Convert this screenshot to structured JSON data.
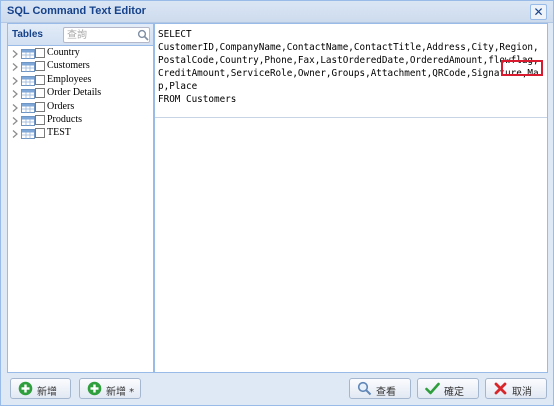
{
  "window": {
    "title": "SQL Command Text Editor"
  },
  "tables_panel": {
    "title": "Tables",
    "search_placeholder": "查詢",
    "items": [
      {
        "label": "Country"
      },
      {
        "label": "Customers"
      },
      {
        "label": "Employees"
      },
      {
        "label": "Order Details"
      },
      {
        "label": "Orders"
      },
      {
        "label": "Products"
      },
      {
        "label": "TEST"
      }
    ]
  },
  "editor": {
    "sql_text": "SELECT\nCustomerID,CompanyName,ContactName,ContactTitle,Address,City,Region,PostalCode,Country,Phone,Fax,LastOrderedDate,OrderedAmount,flowflag,CreditAmount,ServiceRole,Owner,Groups,Attachment,QRCode,Signature,Map,Place\nFROM Customers",
    "highlight_color": "#d81b2f"
  },
  "toolbar": {
    "add_label": "新增",
    "add_star_label": "新增 *",
    "query_label": "查看",
    "ok_label": "確定",
    "cancel_label": "取消"
  },
  "colors": {
    "accent": "#15428b",
    "border": "#99bbe8",
    "add_green": "#2f9e3c",
    "cancel_red": "#d8262a"
  }
}
